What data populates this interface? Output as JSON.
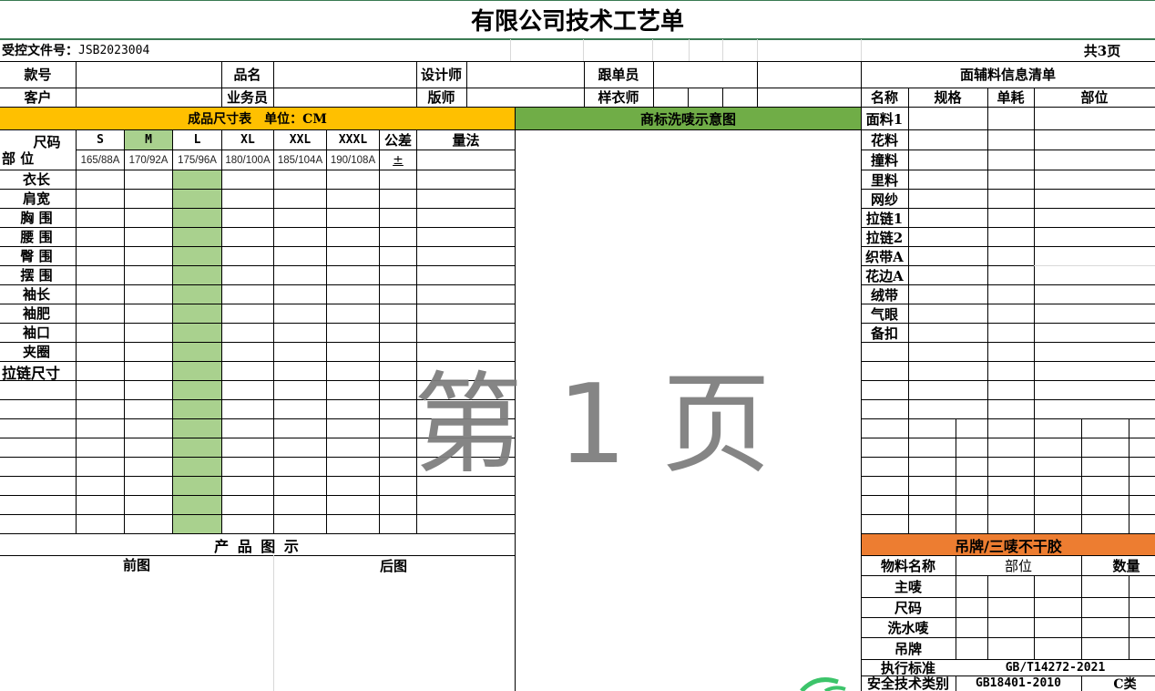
{
  "title": "有限公司技术工艺单",
  "doc_no_label": "受控文件号：",
  "doc_no": "JSB2023004",
  "pages_total": "共3页",
  "watermark": "第 1 页",
  "header": {
    "style_no": "款号",
    "product_name": "品名",
    "designer": "设计师",
    "merchandiser": "跟单员",
    "customer": "客户",
    "salesperson": "业务员",
    "pattern_maker": "版师",
    "sample_maker": "样衣师"
  },
  "size_table": {
    "title": "成品尺寸表　单位：CM",
    "size_label": "尺码",
    "part_label": "部 位",
    "sizes": [
      "S",
      "M",
      "L",
      "XL",
      "XXL",
      "XXXL"
    ],
    "sub_sizes": [
      "165/88A",
      "170/92A",
      "175/96A",
      "180/100A",
      "185/104A",
      "190/108A"
    ],
    "tolerance": "公差",
    "tolerance_sign": "±",
    "method": "量法",
    "parts": [
      "衣长",
      "肩宽",
      "胸 围",
      "腰 围",
      "臀 围",
      "摆 围",
      "袖长",
      "袖肥",
      "袖口",
      "夹圈",
      "拉链尺寸"
    ]
  },
  "label_section": {
    "title": "商标洗唛示意图"
  },
  "materials": {
    "title": "面辅料信息清单",
    "columns": [
      "名称",
      "规格",
      "单耗",
      "部位"
    ],
    "items": [
      "面料1",
      "花料",
      "撞料",
      "里料",
      "网纱",
      "拉链1",
      "拉链2",
      "织带A",
      "花边A",
      "绒带",
      "气眼",
      "备扣"
    ]
  },
  "product": {
    "title": "产 品 图 示",
    "front": "前图",
    "back": "后图"
  },
  "tags": {
    "title": "吊牌/三唛不干胶",
    "col_name": "物料名称",
    "col_part": "部位",
    "col_qty": "数量",
    "items": [
      "主唛",
      "尺码",
      "洗水唛",
      "吊牌"
    ],
    "standard_label": "执行标准",
    "standard_value": "GB/T14272-2021",
    "safety_label": "安全技术类别",
    "safety_value": "GB18401-2010",
    "safety_class": "C类"
  },
  "colors": {
    "size_header": "#ffc000",
    "label_header": "#70ad47",
    "highlight": "#a9d18e",
    "tag_header": "#ed7d31"
  }
}
